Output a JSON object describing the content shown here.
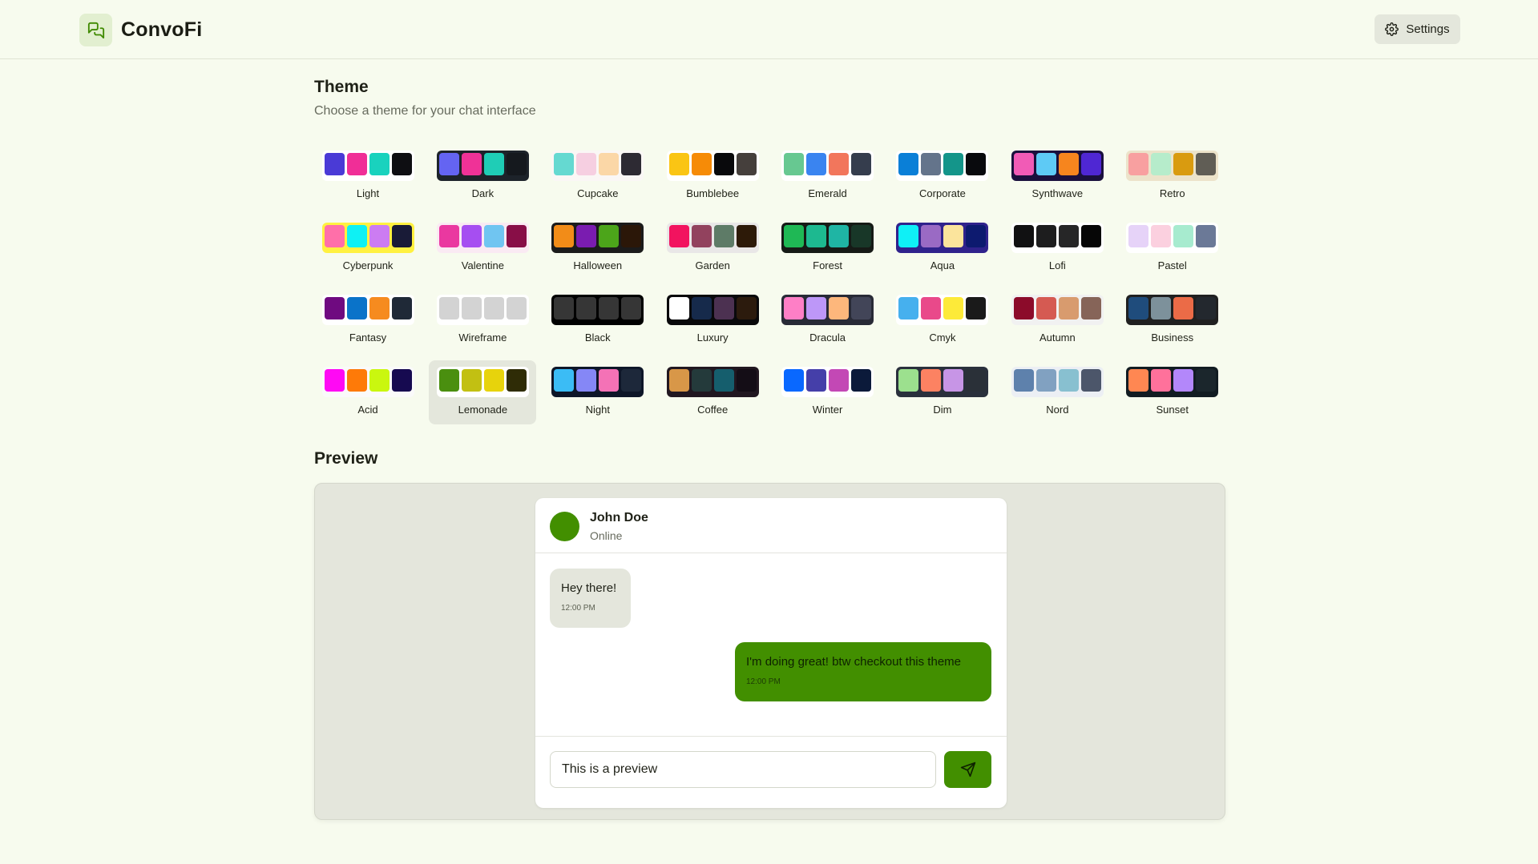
{
  "app": {
    "name": "ConvoFi",
    "logo_icon": "chat-bubbles-icon"
  },
  "header": {
    "settings_label": "Settings",
    "settings_icon": "gear-icon"
  },
  "theme_section": {
    "title": "Theme",
    "subtitle": "Choose a theme for your chat interface",
    "selected": "Lemonade",
    "themes": [
      {
        "name": "Light",
        "frame": "#ffffff",
        "colors": [
          "#4a3ad6",
          "#f02e97",
          "#19d2be",
          "#0e0e12"
        ]
      },
      {
        "name": "Dark",
        "frame": "#1d232a",
        "colors": [
          "#6464f2",
          "#ef3297",
          "#1fcdb6",
          "#15191e"
        ]
      },
      {
        "name": "Cupcake",
        "frame": "#faf7f5",
        "colors": [
          "#65d9d1",
          "#f6cfe1",
          "#fbd7a7",
          "#2d2a33"
        ]
      },
      {
        "name": "Bumblebee",
        "frame": "#ffffff",
        "colors": [
          "#fac514",
          "#f68b07",
          "#09090c",
          "#453f3c"
        ]
      },
      {
        "name": "Emerald",
        "frame": "#ffffff",
        "colors": [
          "#67c891",
          "#3a84f0",
          "#f2765c",
          "#353d4d"
        ]
      },
      {
        "name": "Corporate",
        "frame": "#ffffff",
        "colors": [
          "#0a7fd7",
          "#64748b",
          "#14958a",
          "#090a0d"
        ]
      },
      {
        "name": "Synthwave",
        "frame": "#1a103d",
        "colors": [
          "#f15bb6",
          "#5ecaf5",
          "#f6851e",
          "#4f27d3"
        ]
      },
      {
        "name": "Retro",
        "frame": "#ece3ca",
        "colors": [
          "#f8a0a0",
          "#b6eccb",
          "#d99b10",
          "#605d55"
        ]
      },
      {
        "name": "Cyberpunk",
        "frame": "#fff140",
        "colors": [
          "#ff6fa9",
          "#0ef1f4",
          "#cc7cf2",
          "#191b37"
        ]
      },
      {
        "name": "Valentine",
        "frame": "#faeaf3",
        "colors": [
          "#ea38a0",
          "#a64ef1",
          "#70c5f1",
          "#880e47"
        ]
      },
      {
        "name": "Halloween",
        "frame": "#1b1b1b",
        "colors": [
          "#f28c18",
          "#7a1cb0",
          "#4ca51a",
          "#2b1708"
        ]
      },
      {
        "name": "Garden",
        "frame": "#e9e7e7",
        "colors": [
          "#f2135f",
          "#92425e",
          "#5e7b67",
          "#2d1a08"
        ]
      },
      {
        "name": "Forest",
        "frame": "#161a16",
        "colors": [
          "#1fb855",
          "#1db990",
          "#1fb5a4",
          "#183728"
        ]
      },
      {
        "name": "Aqua",
        "frame": "#30228c",
        "colors": [
          "#0ff0f6",
          "#9a6ac4",
          "#fbe49c",
          "#0d1a6f"
        ]
      },
      {
        "name": "Lofi",
        "frame": "#ffffff",
        "colors": [
          "#111112",
          "#1d1d1e",
          "#262627",
          "#060606"
        ]
      },
      {
        "name": "Pastel",
        "frame": "#ffffff",
        "colors": [
          "#e6d3f8",
          "#fbd0df",
          "#a7ebcf",
          "#6b7997"
        ]
      },
      {
        "name": "Fantasy",
        "frame": "#ffffff",
        "colors": [
          "#6f0a80",
          "#0a73c9",
          "#f68b1f",
          "#1f2937"
        ]
      },
      {
        "name": "Wireframe",
        "frame": "#ffffff",
        "colors": [
          "#d3d3d3",
          "#d3d3d3",
          "#d3d3d3",
          "#d3d3d3"
        ]
      },
      {
        "name": "Black",
        "frame": "#000000",
        "colors": [
          "#363636",
          "#363636",
          "#363636",
          "#363636"
        ]
      },
      {
        "name": "Luxury",
        "frame": "#09090b",
        "colors": [
          "#ffffff",
          "#162a4b",
          "#4c3151",
          "#2c1b0d"
        ]
      },
      {
        "name": "Dracula",
        "frame": "#282a36",
        "colors": [
          "#fe7fc6",
          "#bd97f8",
          "#fdb77c",
          "#424558"
        ]
      },
      {
        "name": "Cmyk",
        "frame": "#ffffff",
        "colors": [
          "#46b0ee",
          "#e9498a",
          "#fdea39",
          "#1a1a1a"
        ]
      },
      {
        "name": "Autumn",
        "frame": "#f1f1f1",
        "colors": [
          "#8c0b2a",
          "#d55a52",
          "#d89b6e",
          "#866458"
        ]
      },
      {
        "name": "Business",
        "frame": "#202020",
        "colors": [
          "#1f4c7c",
          "#7d919b",
          "#eb6b47",
          "#23282e"
        ]
      },
      {
        "name": "Acid",
        "frame": "#fafafa",
        "colors": [
          "#ff09f4",
          "#fe7a08",
          "#caf70f",
          "#160a50"
        ]
      },
      {
        "name": "Lemonade",
        "frame": "#ffffff",
        "colors": [
          "#4a8f0f",
          "#c2c012",
          "#e7d30c",
          "#2f2c06"
        ]
      },
      {
        "name": "Night",
        "frame": "#0e1628",
        "colors": [
          "#3bbcf5",
          "#8587f6",
          "#f472b6",
          "#1d283a"
        ]
      },
      {
        "name": "Coffee",
        "frame": "#211720",
        "colors": [
          "#d89748",
          "#243a3b",
          "#155e6d",
          "#140d16"
        ]
      },
      {
        "name": "Winter",
        "frame": "#ffffff",
        "colors": [
          "#0968ff",
          "#453fa9",
          "#c348b5",
          "#0b1a3a"
        ]
      },
      {
        "name": "Dim",
        "frame": "#2a303c",
        "colors": [
          "#9ce08e",
          "#fc8262",
          "#c795e6",
          "#2a3038"
        ]
      },
      {
        "name": "Nord",
        "frame": "#eceff4",
        "colors": [
          "#5e81ac",
          "#81a1c1",
          "#88c0d0",
          "#4c566a"
        ]
      },
      {
        "name": "Sunset",
        "frame": "#121c22",
        "colors": [
          "#ff8752",
          "#ff719b",
          "#b387fa",
          "#1b262c"
        ]
      }
    ]
  },
  "preview": {
    "title": "Preview",
    "contact": {
      "name": "John Doe",
      "status": "Online"
    },
    "messages": [
      {
        "text": "Hey there!",
        "time": "12:00 PM",
        "direction": "in"
      },
      {
        "text": "I'm doing great! btw checkout this theme",
        "time": "12:00 PM",
        "direction": "out"
      }
    ],
    "input_value": "This is a preview",
    "send_icon": "send-icon"
  },
  "colors": {
    "accent": "#428f00",
    "background": "#f7fbee",
    "muted": "#e4e7dc"
  }
}
